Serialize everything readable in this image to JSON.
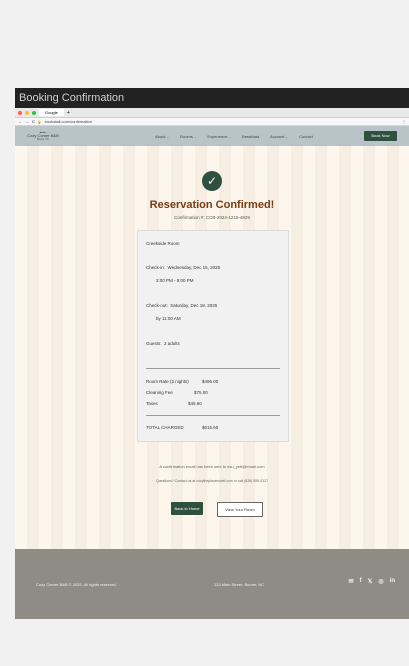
{
  "window": {
    "title": "Booking Confirmation"
  },
  "browser": {
    "tab_label": "Google",
    "new_tab": "+",
    "url": "bookstall.com/confirmation",
    "back": "←",
    "forward": "→",
    "reload": "C",
    "lock": "🔒",
    "more": "⋮"
  },
  "nav": {
    "logo_name": "Cozy Corner B&B",
    "logo_tagline": "Boone, NC",
    "items": [
      {
        "label": "About",
        "caret": "⌄"
      },
      {
        "label": "Rooms",
        "caret": "⌄"
      },
      {
        "label": "Experience",
        "caret": "⌄"
      },
      {
        "label": "Breakfast",
        "caret": ""
      },
      {
        "label": "Account",
        "caret": "⌄"
      },
      {
        "label": "Contact",
        "caret": ""
      }
    ],
    "book_label": "Book Now"
  },
  "confirmation": {
    "check_glyph": "✓",
    "heading": "Reservation Confirmed!",
    "number": "Confirmation #: CCB-2024-1215-4829"
  },
  "details": {
    "room": "Creekside Room",
    "checkin_label": "Check-in:",
    "checkin_date": "Wednesday, Dec 15, 2025",
    "checkin_time": "3:00 PM - 8:00 PM",
    "checkout_label": "Check-out:",
    "checkout_date": "Saturday, Dec 18, 2025",
    "checkout_time": "by 11:00 AM",
    "guests_label": "Guests:",
    "guests": "2 adults",
    "room_rate_label": "Room Rate (3 nights)",
    "room_rate": "$495.00",
    "cleaning_label": "Cleaning Fee",
    "cleaning": "$75.00",
    "taxes_label": "Taxes",
    "taxes": "$45.60",
    "total_label": "TOTAL CHARGED",
    "total": "$615.60"
  },
  "messages": {
    "email_sent": "A confirmation email has been sent to esu_yett@email.com",
    "questions": "Questions? Contact us at cozyfireplacemotel.com or call (828) 555-0127"
  },
  "actions": {
    "home": "Back to Home",
    "view_room": "View Your Room"
  },
  "footer": {
    "copyright": "Cozy Corner B&B © 2025. All rights reserved.",
    "address": "123 Main Street, Boone, NC",
    "social": [
      "✉",
      "f",
      "𝕏",
      "◎",
      "in"
    ]
  },
  "colors": {
    "accent": "#2f4f3f",
    "heading": "#7a3b12",
    "nav_bg": "#b9c4c9",
    "page_bg": "#fdf6ec",
    "footer_bg": "#8f8c86"
  }
}
